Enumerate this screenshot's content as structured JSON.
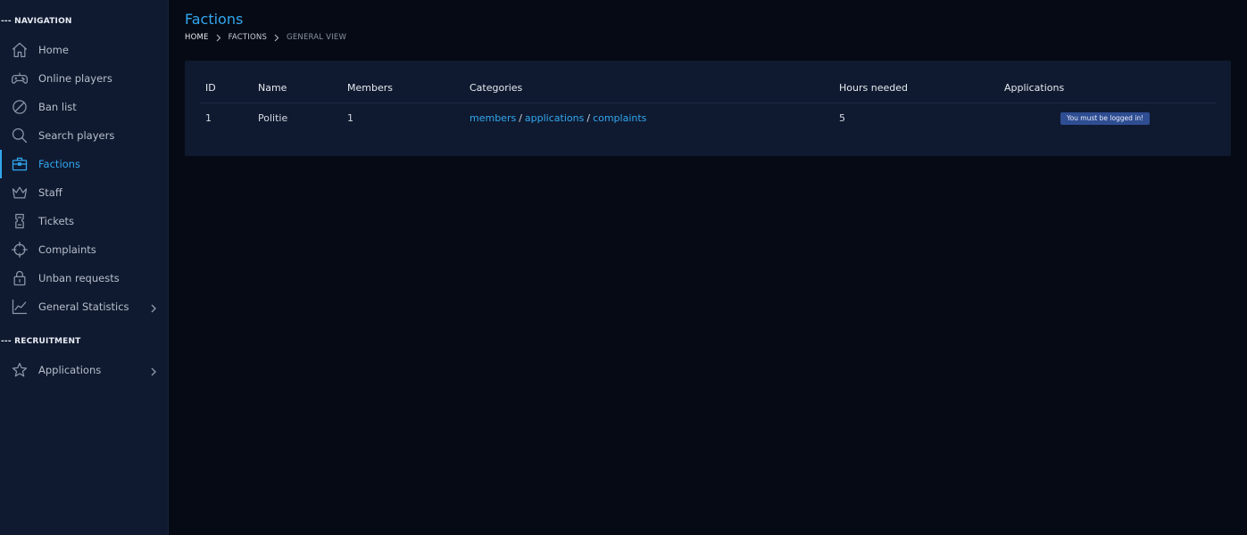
{
  "sidebar": {
    "navigation_title": "--- NAVIGATION",
    "items": [
      {
        "label": "Home",
        "icon": "home-icon"
      },
      {
        "label": "Online players",
        "icon": "gamepad-icon"
      },
      {
        "label": "Ban list",
        "icon": "ban-icon"
      },
      {
        "label": "Search players",
        "icon": "search-icon"
      },
      {
        "label": "Factions",
        "icon": "briefcase-icon",
        "active": true
      },
      {
        "label": "Staff",
        "icon": "crown-icon"
      },
      {
        "label": "Tickets",
        "icon": "ticket-icon"
      },
      {
        "label": "Complaints",
        "icon": "crosshair-icon"
      },
      {
        "label": "Unban requests",
        "icon": "lock-icon"
      },
      {
        "label": "General Statistics",
        "icon": "chart-line-icon",
        "expandable": true
      }
    ],
    "recruitment_title": "--- RECRUITMENT",
    "recruitment_items": [
      {
        "label": "Applications",
        "icon": "star-icon",
        "expandable": true
      }
    ]
  },
  "header": {
    "title": "Factions",
    "breadcrumb": [
      "HOME",
      "FACTIONS",
      "GENERAL VIEW"
    ]
  },
  "table": {
    "columns": [
      "ID",
      "Name",
      "Members",
      "Categories",
      "Hours needed",
      "Applications"
    ],
    "rows": [
      {
        "id": "1",
        "name": "Politie",
        "members": "1",
        "categories": [
          "members",
          "applications",
          "complaints"
        ],
        "category_separator": "/",
        "hours_needed": "5",
        "applications_badge": "You must be logged in!"
      }
    ]
  },
  "colors": {
    "accent": "#33a7f0",
    "background": "#060a14",
    "panel": "#0f1a30",
    "badge": "#2e4d92"
  }
}
